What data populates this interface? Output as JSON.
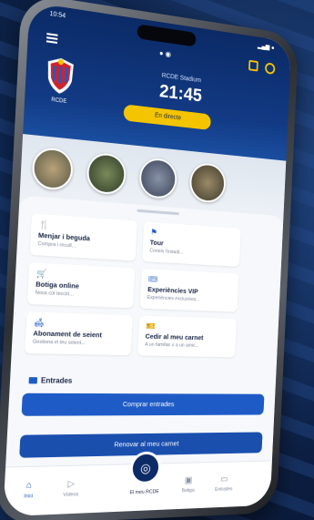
{
  "status_bar": {
    "time": "10:54",
    "signal": "▂▄▆ ●"
  },
  "header": {
    "center_indicator": "● ◉",
    "club_short": "RCDE",
    "stadium": "RCDE Stadium",
    "time": "21:45",
    "live_button": "En directe"
  },
  "tiles": [
    {
      "icon": "🍴",
      "title": "Menjar i beguda",
      "subtitle": "Compra i recull..."
    },
    {
      "icon": "⚑",
      "title": "Tour",
      "subtitle": "Coneix l'estadi..."
    },
    {
      "icon": "🛒",
      "title": "Botiga online",
      "subtitle": "Nova col·lecció..."
    },
    {
      "icon": "🎟",
      "title": "Experiències VIP",
      "subtitle": "Experiències exclusives..."
    },
    {
      "icon": "🛋",
      "title": "Abonament de seient",
      "subtitle": "Gestiona el teu seient..."
    },
    {
      "icon": "🎫",
      "title": "Cedir al meu carnet",
      "subtitle": "A un familiar o a un amic..."
    }
  ],
  "tickets": {
    "title": "Entrades",
    "buy_button": "Comprar entrades",
    "renew_button": "Renovar al meu carnet"
  },
  "tabbar": [
    {
      "icon": "⌂",
      "label": "Inici"
    },
    {
      "icon": "▷",
      "label": "Vídeos"
    },
    {
      "icon": "◎",
      "label": "El meu RCDE"
    },
    {
      "icon": "▣",
      "label": "Botiga"
    },
    {
      "icon": "▭",
      "label": "Entrades"
    }
  ],
  "colors": {
    "navy": "#0b2a66",
    "accent": "#1e5bc6",
    "yellow": "#f5c400"
  }
}
